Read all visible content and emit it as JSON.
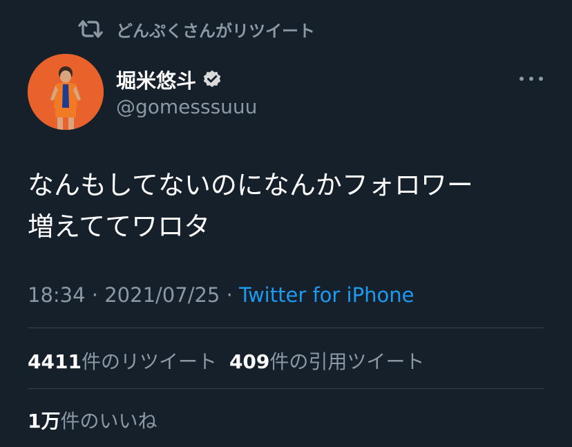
{
  "retweet_banner": {
    "icon": "retweet-icon",
    "text": "どんぷくさんがリツイート"
  },
  "author": {
    "display_name": "堀米悠斗",
    "handle": "@gomesssuuu",
    "verified_icon": "verified-badge-icon",
    "avatar_bg": "#e9622b"
  },
  "more_icon": "more-dots-icon",
  "tweet": {
    "line1": "なんもしてないのになんかフォロワー",
    "line2": "増えててワロタ"
  },
  "meta": {
    "time": "18:34",
    "sep1": " · ",
    "date": "2021/07/25",
    "sep2": " · ",
    "source": "Twitter for iPhone"
  },
  "stats": {
    "retweets_count": "4411",
    "retweets_label": "件のリツイート",
    "quotes_count": "409",
    "quotes_label": "件の引用ツイート",
    "likes_count": "1万",
    "likes_label": "件のいいね"
  },
  "colors": {
    "background": "#15202b",
    "secondary_text": "#8b98a5",
    "link": "#1d9bf0",
    "divider": "#38444d"
  }
}
